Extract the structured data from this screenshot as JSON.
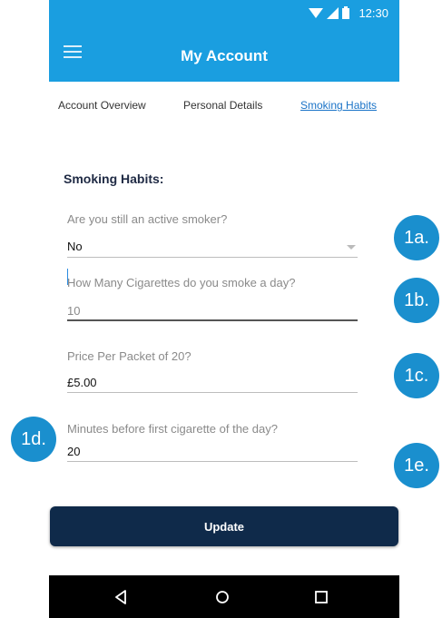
{
  "status_bar": {
    "time": "12:30"
  },
  "app_bar": {
    "title": "My Account"
  },
  "tabs": [
    {
      "label": "Account Overview"
    },
    {
      "label": "Personal Details"
    },
    {
      "label": "Smoking Habits"
    }
  ],
  "section": {
    "title": "Smoking Habits:"
  },
  "fields": {
    "active_smoker": {
      "label": "Are you still an active smoker?",
      "value": "No"
    },
    "cigarettes_per_day": {
      "label": "How Many Cigarettes do you smoke a day?",
      "value": "10"
    },
    "price_per_packet": {
      "label": "Price Per Packet of 20?",
      "value": "£5.00"
    },
    "minutes_first_cigarette": {
      "label": "Minutes before first cigarette of the day?",
      "value": "20"
    }
  },
  "update_button": {
    "label": "Update"
  },
  "annotations": {
    "a": "1a.",
    "b": "1b.",
    "c": "1c.",
    "d": "1d.",
    "e": "1e."
  },
  "colors": {
    "primary": "#1a9ee0",
    "button": "#0f2a4a",
    "badge": "#1a8fce",
    "active_tab": "#1a73c7"
  }
}
